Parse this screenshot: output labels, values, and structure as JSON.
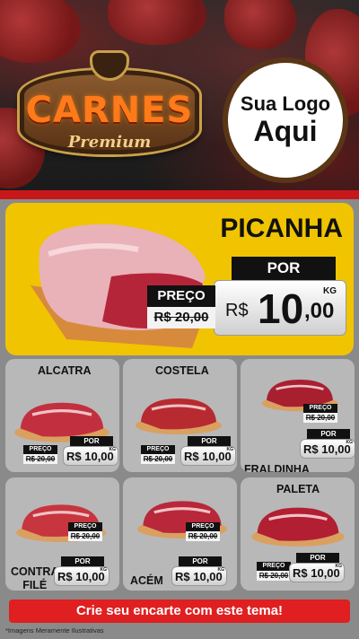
{
  "header": {
    "brand_main": "CARNES",
    "brand_sub": "Premium",
    "logo_line1": "Sua Logo",
    "logo_line2": "Aqui"
  },
  "featured": {
    "name": "PICANHA",
    "por_label": "POR",
    "preco_label": "PREÇO",
    "old_price": "R$ 20,00",
    "currency": "R$",
    "price_int": "10",
    "price_dec": ",00",
    "unit": "KG"
  },
  "cards": [
    {
      "name": "ALCATRA",
      "preco_label": "PREÇO",
      "old_price": "R$ 20,00",
      "por_label": "POR",
      "price": "R$ 10,00",
      "unit": "KG"
    },
    {
      "name": "COSTELA",
      "preco_label": "PREÇO",
      "old_price": "R$ 20,00",
      "por_label": "POR",
      "price": "R$ 10,00",
      "unit": "KG"
    },
    {
      "name": "FRALDINHA",
      "preco_label": "PREÇO",
      "old_price": "R$ 20,00",
      "por_label": "POR",
      "price": "R$ 10,00",
      "unit": "KG"
    },
    {
      "name_line1": "CONTRA",
      "name_line2": "FILÉ",
      "preco_label": "PREÇO",
      "old_price": "R$ 20,00",
      "por_label": "POR",
      "price": "R$ 10,00",
      "unit": "KG"
    },
    {
      "name": "ACÉM",
      "preco_label": "PREÇO",
      "old_price": "R$ 20,00",
      "por_label": "POR",
      "price": "R$ 10,00",
      "unit": "KG"
    },
    {
      "name": "PALETA",
      "preco_label": "PREÇO",
      "old_price": "R$ 20,00",
      "por_label": "POR",
      "price": "R$ 10,00",
      "unit": "KG"
    }
  ],
  "cta": "Crie seu encarte com este tema!",
  "footnote": "*Imagens Meramente Ilustrativas",
  "colors": {
    "yellow": "#f0c400",
    "red": "#e01f20",
    "dark": "#111111"
  }
}
